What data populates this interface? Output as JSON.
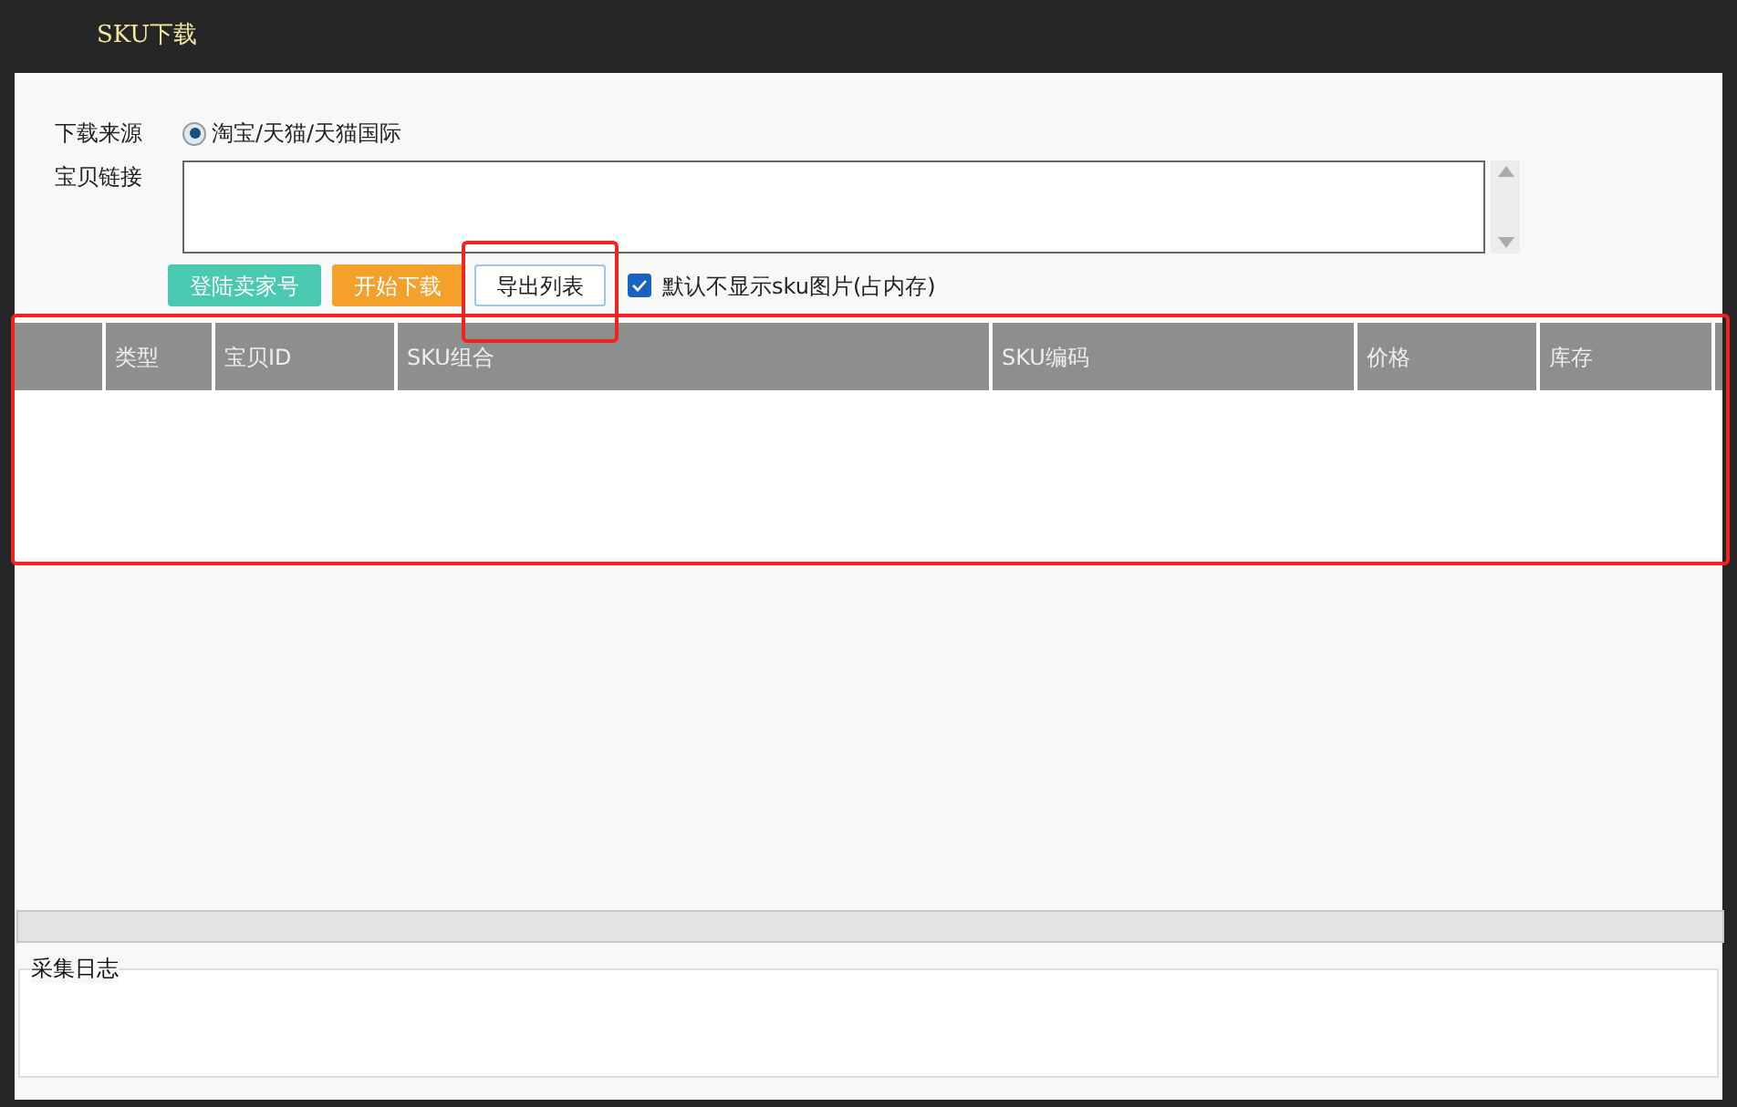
{
  "window": {
    "title": "SKU下载"
  },
  "source": {
    "label": "下载来源",
    "options": [
      {
        "label": "淘宝/天猫/天猫国际",
        "selected": true
      }
    ]
  },
  "link": {
    "label": "宝贝链接"
  },
  "buttons": [
    {
      "label": "登陆卖家号",
      "kind": "teal",
      "highlighted": false
    },
    {
      "label": "开始下载",
      "kind": "orange",
      "highlighted": false
    },
    {
      "label": "导出列表",
      "kind": "outline",
      "highlighted": true
    }
  ],
  "hide_images": {
    "label": "默认不显示sku图片(占内存)",
    "checked": true
  },
  "table": {
    "highlighted": true,
    "columns": [
      "",
      "类型",
      "宝贝ID",
      "SKU组合",
      "SKU编码",
      "价格",
      "库存"
    ]
  },
  "log": {
    "title": "采集日志"
  }
}
